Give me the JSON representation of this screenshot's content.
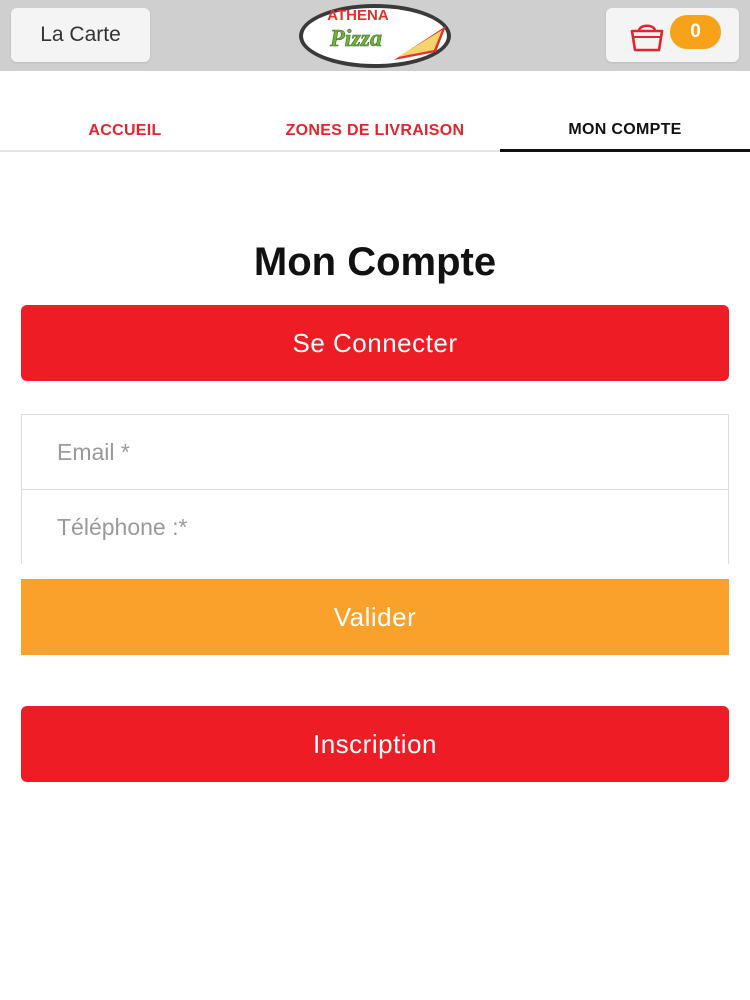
{
  "header": {
    "menu_label": "La Carte",
    "logo": {
      "line1": "ATHENA",
      "line2": "Pizza"
    },
    "cart_count": "0",
    "cart_icon": "shopping-bag-icon"
  },
  "tabs": [
    {
      "label": "ACCUEIL",
      "active": false
    },
    {
      "label": "ZONES DE LIVRAISON",
      "active": false
    },
    {
      "label": "MON COMPTE",
      "active": true
    }
  ],
  "main": {
    "title": "Mon Compte",
    "login_label": "Se Connecter",
    "email_placeholder": "Email *",
    "phone_placeholder": "Téléphone :*",
    "submit_label": "Valider",
    "register_label": "Inscription"
  },
  "colors": {
    "red": "#ee1c25",
    "orange": "#f9a12b",
    "topbar": "#cfcfcf"
  }
}
